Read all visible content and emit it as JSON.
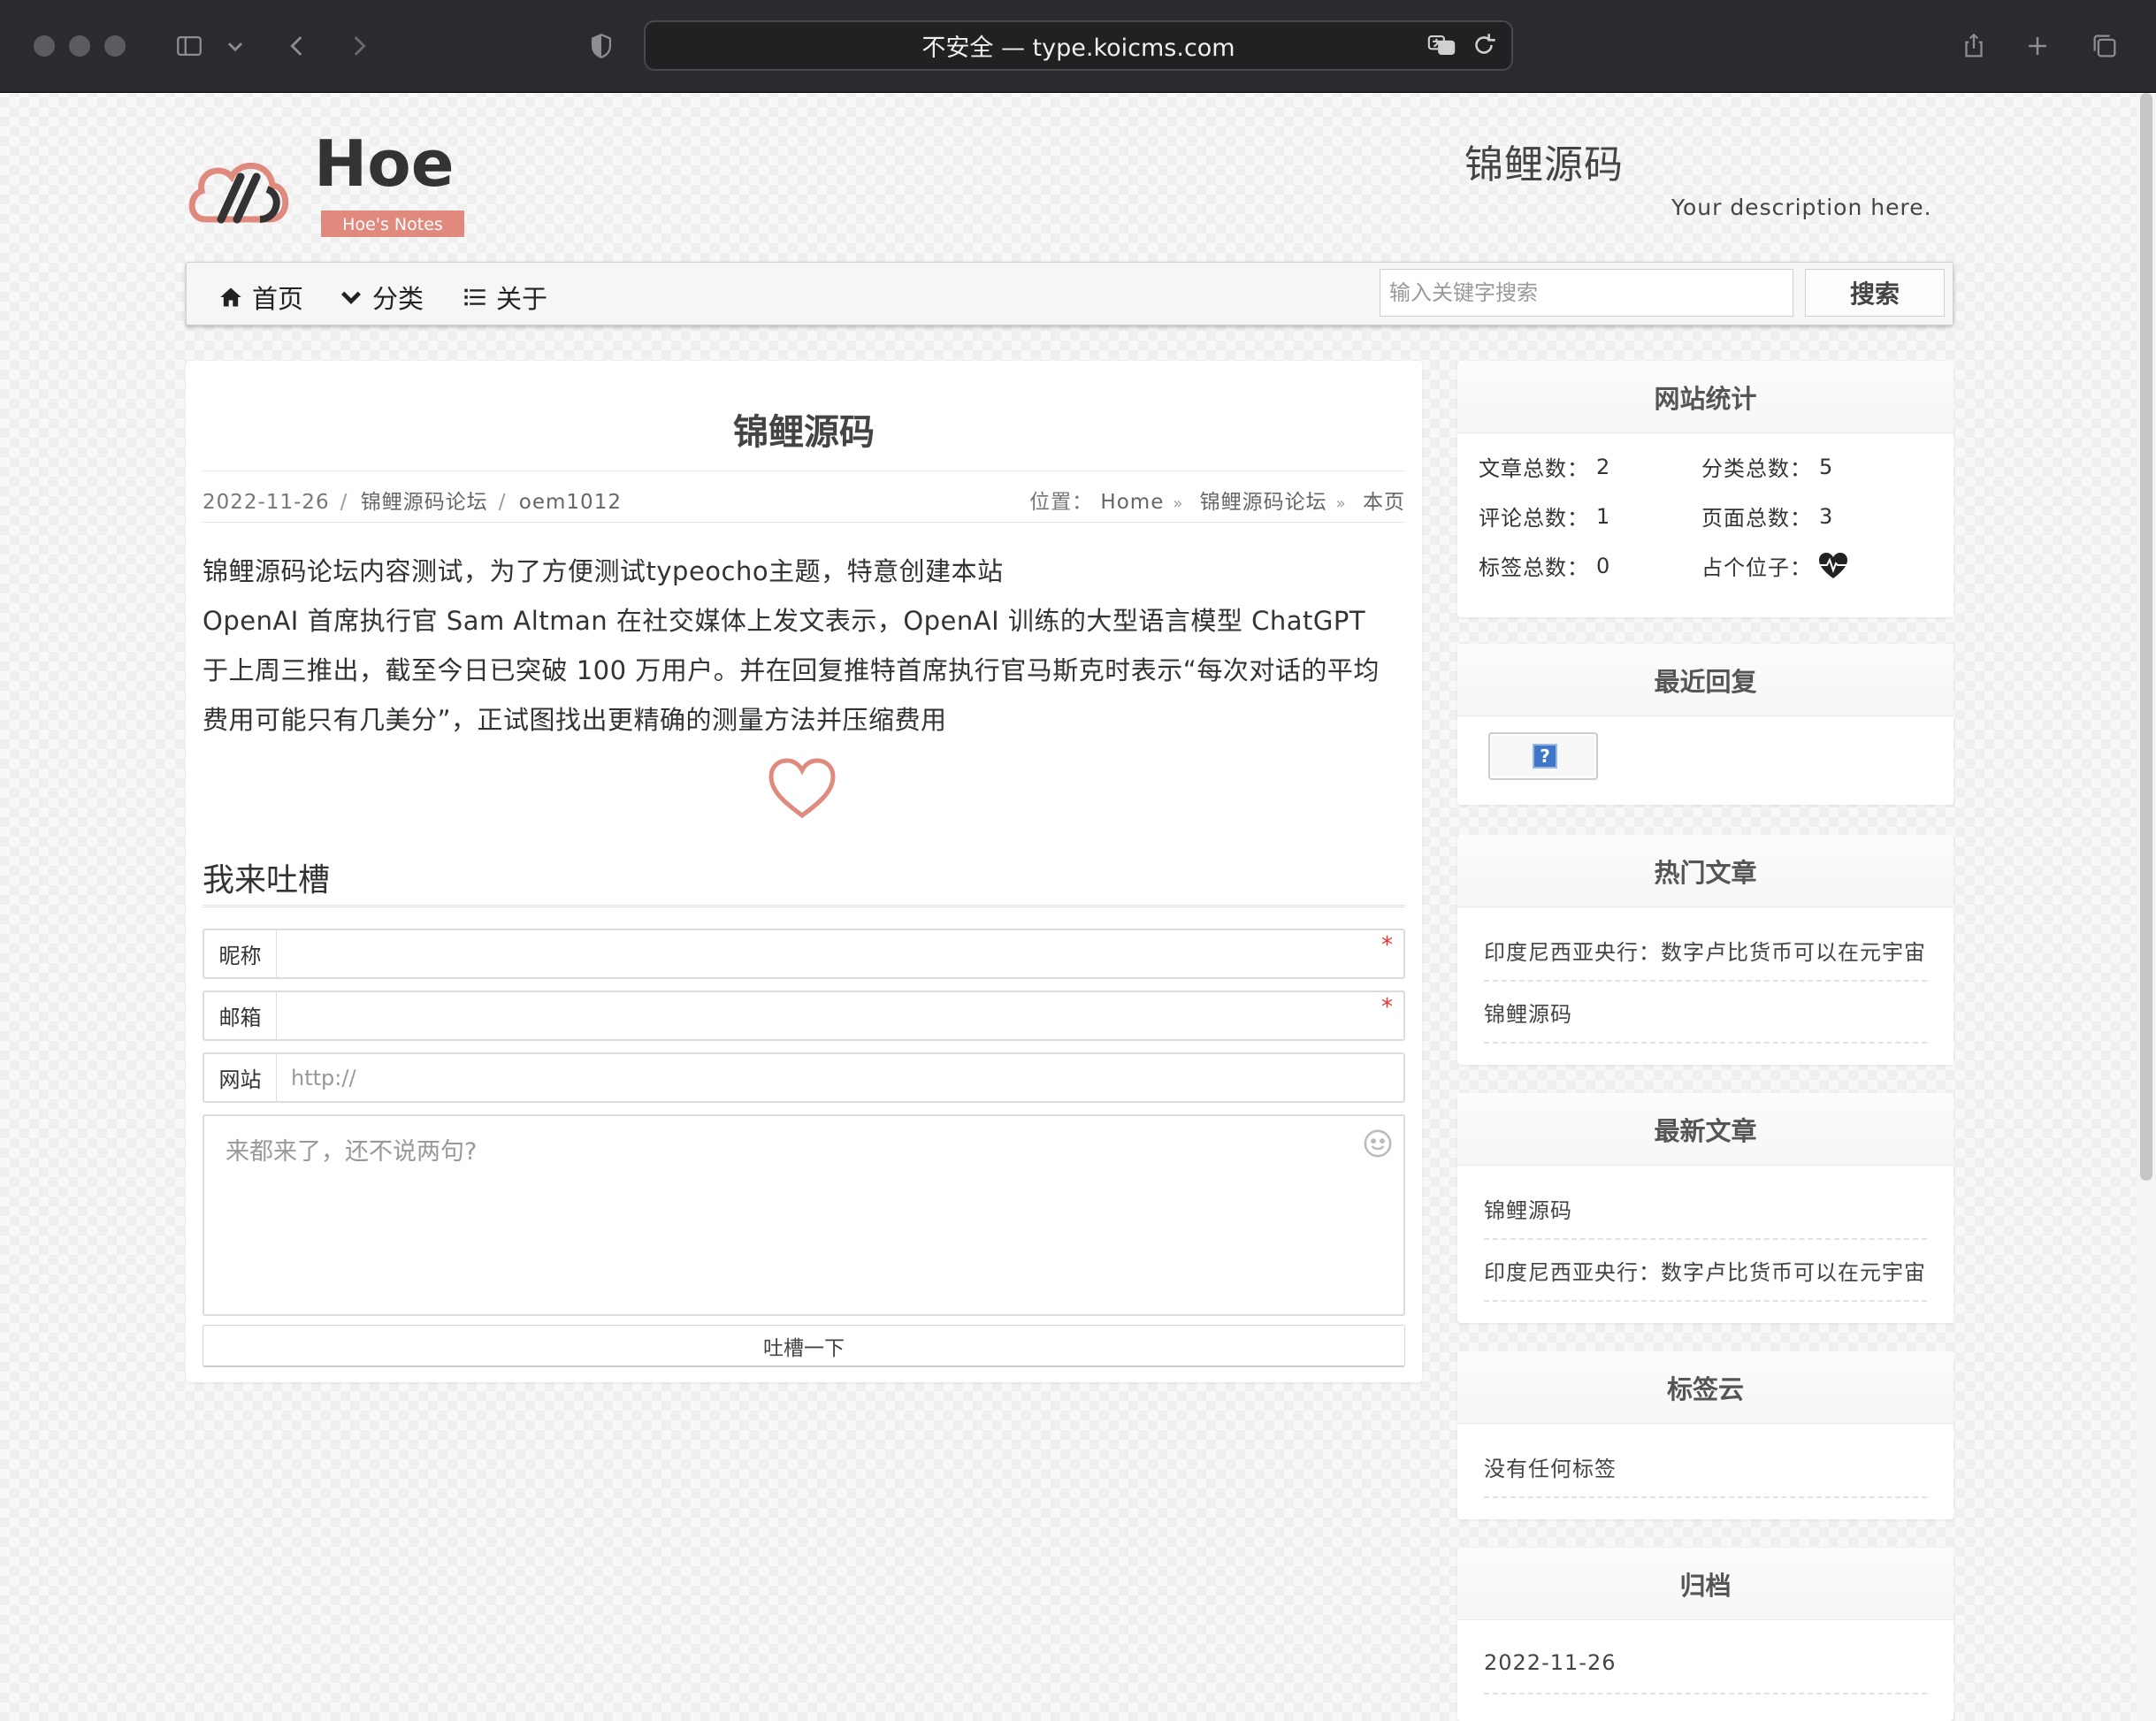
{
  "browser": {
    "url": "不安全 — type.koicms.com"
  },
  "header": {
    "logo_text": "Hoe",
    "logo_sub": "Hoe's Notes",
    "site_title": "锦鲤源码",
    "site_description": "Your description here."
  },
  "nav": {
    "items": [
      {
        "label": "首页",
        "icon": "home-icon"
      },
      {
        "label": "分类",
        "icon": "chevron-down-icon"
      },
      {
        "label": "关于",
        "icon": "list-icon"
      }
    ],
    "search_placeholder": "输入关键字搜索",
    "search_button": "搜索"
  },
  "post": {
    "title": "锦鲤源码",
    "date": "2022-11-26",
    "category": "锦鲤源码论坛",
    "author": "oem1012",
    "breadcrumb_label": "位置：",
    "breadcrumb": [
      "Home",
      "锦鲤源码论坛",
      "本页"
    ],
    "body_lines": [
      "锦鲤源码论坛内容测试，为了方便测试typeocho主题，特意创建本站",
      "OpenAI 首席执行官 Sam Altman 在社交媒体上发文表示，OpenAI 训练的大型语言模型 ChatGPT",
      "于上周三推出，截至今日已突破 100 万用户。并在回复推特首席执行官马斯克时表示“每次对话的平均",
      "费用可能只有几美分”，正试图找出更精确的测量方法并压缩费用"
    ]
  },
  "comment_form": {
    "heading": "我来吐槽",
    "nickname_label": "昵称",
    "email_label": "邮箱",
    "website_label": "网站",
    "website_placeholder": "http://",
    "required_mark": "*",
    "textarea_placeholder": "来都来了，还不说两句?",
    "submit_label": "吐槽一下"
  },
  "sidebar": {
    "stats": {
      "title": "网站统计",
      "articles_label": "文章总数：",
      "articles": "2",
      "categories_label": "分类总数：",
      "categories": "5",
      "comments_label": "评论总数：",
      "comments": "1",
      "pages_label": "页面总数：",
      "pages": "3",
      "tags_label": "标签总数：",
      "tags": "0",
      "placeholder_label": "占个位子："
    },
    "recent_replies": {
      "title": "最近回复",
      "avatar_glyph": "?"
    },
    "hot_posts": {
      "title": "热门文章",
      "items": [
        "印度尼西亚央行：数字卢比货币可以在元宇宙",
        "锦鲤源码"
      ]
    },
    "latest_posts": {
      "title": "最新文章",
      "items": [
        "锦鲤源码",
        "印度尼西亚央行：数字卢比货币可以在元宇宙"
      ]
    },
    "tag_cloud": {
      "title": "标签云",
      "empty_text": "没有任何标签"
    },
    "archive": {
      "title": "归档",
      "items": [
        "2022-11-26"
      ]
    }
  }
}
